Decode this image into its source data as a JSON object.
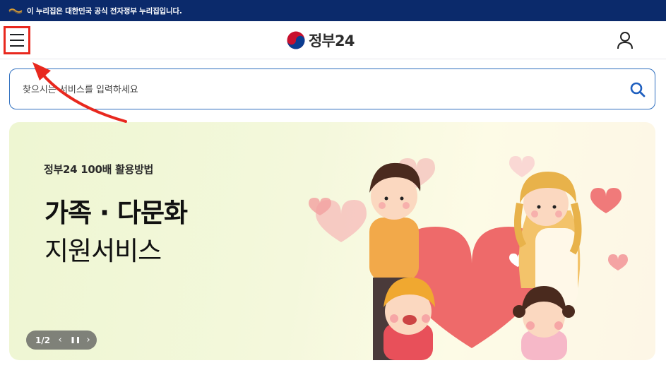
{
  "gov_bar": {
    "text": "이 누리집은 대한민국 공식 전자정부 누리집입니다."
  },
  "header": {
    "logo_text": "정부24"
  },
  "search": {
    "placeholder": "찾으시는 서비스를 입력하세요"
  },
  "banner": {
    "subtitle": "정부24 100배 활용방법",
    "title_line1": "가족 · 다문화",
    "title_line2": "지원서비스",
    "pager": {
      "count": "1/2"
    }
  },
  "colors": {
    "gov_bar": "#0b2a6b",
    "accent_blue": "#2f6fbf",
    "annotation_red": "#e8281e"
  },
  "icons": [
    "menu-icon",
    "taegeuk-logo-icon",
    "user-icon",
    "search-icon",
    "prev-icon",
    "pause-icon",
    "next-icon"
  ]
}
